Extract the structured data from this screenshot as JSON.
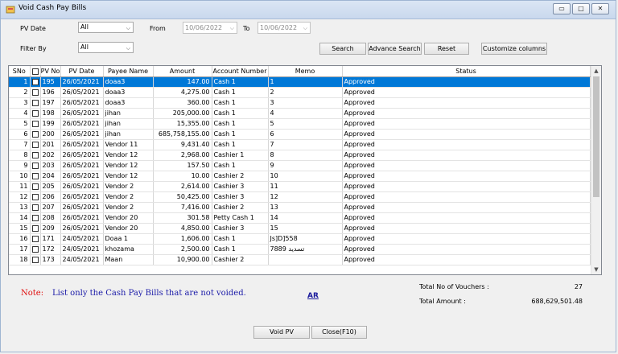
{
  "window": {
    "title": "Void Cash Pay Bills",
    "controls": {
      "minimize": "▭",
      "maximize": "□",
      "close": "✕"
    }
  },
  "filters": {
    "pv_date_label": "PV Date",
    "pv_date_value": "All",
    "from_label": "From",
    "from_value": "10/06/2022",
    "to_label": "To",
    "to_value": "10/06/2022",
    "filter_by_label": "Filter By",
    "filter_by_value": "All"
  },
  "toolbar": {
    "search": "Search",
    "advance_search": "Advance Search",
    "reset": "Reset",
    "customize_columns": "Customize columns"
  },
  "grid": {
    "columns": [
      "SNo",
      "",
      "PV No",
      "PV Date",
      "Payee Name",
      "Amount",
      "Account Number",
      "Memo",
      "Status"
    ],
    "rows": [
      {
        "sno": "1",
        "pv": "195",
        "date": "26/05/2021",
        "payee": "doaa3",
        "amount": "147.00",
        "account": "Cash 1",
        "memo": "1",
        "status": "Approved"
      },
      {
        "sno": "2",
        "pv": "196",
        "date": "26/05/2021",
        "payee": "doaa3",
        "amount": "4,275.00",
        "account": "Cash 1",
        "memo": "2",
        "status": "Approved"
      },
      {
        "sno": "3",
        "pv": "197",
        "date": "26/05/2021",
        "payee": "doaa3",
        "amount": "360.00",
        "account": "Cash 1",
        "memo": "3",
        "status": "Approved"
      },
      {
        "sno": "4",
        "pv": "198",
        "date": "26/05/2021",
        "payee": "jihan",
        "amount": "205,000.00",
        "account": "Cash 1",
        "memo": "4",
        "status": "Approved"
      },
      {
        "sno": "5",
        "pv": "199",
        "date": "26/05/2021",
        "payee": "jihan",
        "amount": "15,355.00",
        "account": "Cash 1",
        "memo": "5",
        "status": "Approved"
      },
      {
        "sno": "6",
        "pv": "200",
        "date": "26/05/2021",
        "payee": "jihan",
        "amount": "685,758,155.00",
        "account": "Cash 1",
        "memo": "6",
        "status": "Approved"
      },
      {
        "sno": "7",
        "pv": "201",
        "date": "26/05/2021",
        "payee": "Vendor 11",
        "amount": "9,431.40",
        "account": "Cash 1",
        "memo": "7",
        "status": "Approved"
      },
      {
        "sno": "8",
        "pv": "202",
        "date": "26/05/2021",
        "payee": "Vendor 12",
        "amount": "2,968.00",
        "account": "Cashier 1",
        "memo": "8",
        "status": "Approved"
      },
      {
        "sno": "9",
        "pv": "203",
        "date": "26/05/2021",
        "payee": "Vendor 12",
        "amount": "157.50",
        "account": "Cash 1",
        "memo": "9",
        "status": "Approved"
      },
      {
        "sno": "10",
        "pv": "204",
        "date": "26/05/2021",
        "payee": "Vendor 12",
        "amount": "10.00",
        "account": "Cashier 2",
        "memo": "10",
        "status": "Approved"
      },
      {
        "sno": "11",
        "pv": "205",
        "date": "26/05/2021",
        "payee": "Vendor 2",
        "amount": "2,614.00",
        "account": "Cashier 3",
        "memo": "11",
        "status": "Approved"
      },
      {
        "sno": "12",
        "pv": "206",
        "date": "26/05/2021",
        "payee": "Vendor 2",
        "amount": "50,425.00",
        "account": "Cashier 3",
        "memo": "12",
        "status": "Approved"
      },
      {
        "sno": "13",
        "pv": "207",
        "date": "26/05/2021",
        "payee": "Vendor 2",
        "amount": "7,416.00",
        "account": "Cashier 2",
        "memo": "13",
        "status": "Approved"
      },
      {
        "sno": "14",
        "pv": "208",
        "date": "26/05/2021",
        "payee": "Vendor 20",
        "amount": "301.58",
        "account": "Petty Cash  1",
        "memo": "14",
        "status": "Approved"
      },
      {
        "sno": "15",
        "pv": "209",
        "date": "26/05/2021",
        "payee": "Vendor 20",
        "amount": "4,850.00",
        "account": "Cashier 3",
        "memo": "15",
        "status": "Approved"
      },
      {
        "sno": "16",
        "pv": "171",
        "date": "24/05/2021",
        "payee": "Doaa 1",
        "amount": "1,606.00",
        "account": "Cash 1",
        "memo": "Js]D]558",
        "status": "Approved"
      },
      {
        "sno": "17",
        "pv": "172",
        "date": "24/05/2021",
        "payee": "khozama",
        "amount": "2,500.00",
        "account": "Cash 1",
        "memo": "تسديد 7889",
        "status": "Approved"
      },
      {
        "sno": "18",
        "pv": "173",
        "date": "24/05/2021",
        "payee": "Maan",
        "amount": "10,900.00",
        "account": "Cashier 2",
        "memo": "",
        "status": "Approved"
      }
    ],
    "selected_row": 0
  },
  "footer": {
    "note_label": "Note:",
    "note_text": "List only the Cash Pay Bills that are not voided.",
    "ar_link": "AR",
    "total_vouchers_label": "Total No of Vouchers :",
    "total_vouchers_value": "27",
    "total_amount_label": "Total Amount :",
    "total_amount_value": "688,629,501.48",
    "void_button": "Void PV",
    "close_button": "Close(F10)"
  },
  "colors": {
    "selection": "#0078d7",
    "note_label": "#e01010",
    "note_text": "#1a1aa8"
  }
}
